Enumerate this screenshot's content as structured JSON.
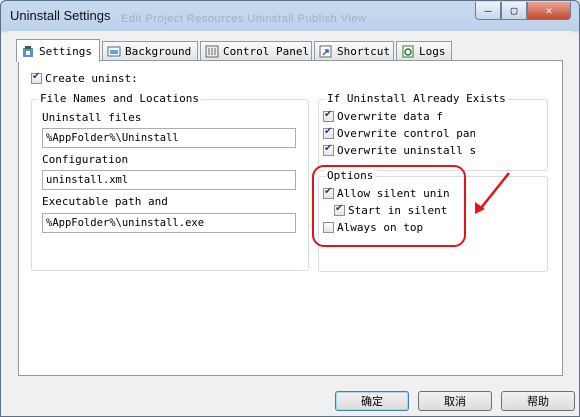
{
  "window": {
    "title": "Uninstall Settings",
    "background_menu": "Edit   Project   Resources   Uninstall   Publish   View"
  },
  "tabs": [
    {
      "label": "Settings",
      "active": true,
      "icon": "settings-icon"
    },
    {
      "label": "Background",
      "active": false,
      "icon": "background-icon"
    },
    {
      "label": "Control Panel",
      "active": false,
      "icon": "control-panel-icon"
    },
    {
      "label": "Shortcut",
      "active": false,
      "icon": "shortcut-icon"
    },
    {
      "label": "Logs",
      "active": false,
      "icon": "logs-icon"
    }
  ],
  "settings": {
    "create_uninst": {
      "label": "Create uninst:",
      "checked": true
    },
    "file_names": {
      "title": "File Names and Locations",
      "uninstall_files_label": "Uninstall files",
      "uninstall_files_value": "%AppFolder%\\Uninstall",
      "configuration_label": "Configuration",
      "configuration_value": "uninstall.xml",
      "exe_label": "Executable path and",
      "exe_value": "%AppFolder%\\uninstall.exe"
    },
    "already_exists": {
      "title": "If Uninstall Already Exists",
      "items": [
        {
          "label": "Overwrite data f",
          "checked": true
        },
        {
          "label": "Overwrite control panel",
          "checked": true
        },
        {
          "label": "Overwrite uninstall sho",
          "checked": true
        }
      ]
    },
    "options": {
      "title": "Options",
      "allow_silent": {
        "label": "Allow silent unin",
        "checked": true
      },
      "start_silent": {
        "label": "Start in silent :",
        "checked": true
      },
      "always_on_top": {
        "label": "Always on top",
        "checked": false
      }
    }
  },
  "buttons": {
    "ok": "确定",
    "cancel": "取消",
    "help": "帮助"
  },
  "colors": {
    "annotation": "#e31414",
    "checkmark": "#1b3f8a"
  }
}
